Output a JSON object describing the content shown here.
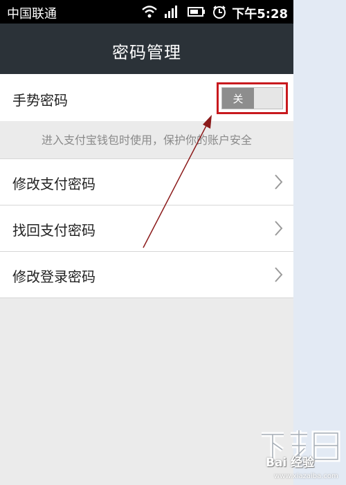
{
  "status_bar": {
    "carrier": "中国联通",
    "time": "下午5:28"
  },
  "header": {
    "title": "密码管理"
  },
  "gesture": {
    "label": "手势密码",
    "toggle_state": "关"
  },
  "hint": "进入支付宝钱包时使用，保护你的账户安全",
  "menu": [
    {
      "label": "修改支付密码"
    },
    {
      "label": "找回支付密码"
    },
    {
      "label": "修改登录密码"
    }
  ],
  "watermark": {
    "logo": "下载吧",
    "brand": "Bai 经验",
    "url": "www.xiazaiba.com"
  },
  "colors": {
    "titlebar": "#2b3238",
    "highlight": "#c8191e",
    "arrow": "#8b1a1a",
    "toggle_knob": "#8d8d8d"
  },
  "icons": [
    "wifi-icon",
    "signal-icon",
    "battery-icon",
    "alarm-icon",
    "chevron-right-icon"
  ]
}
